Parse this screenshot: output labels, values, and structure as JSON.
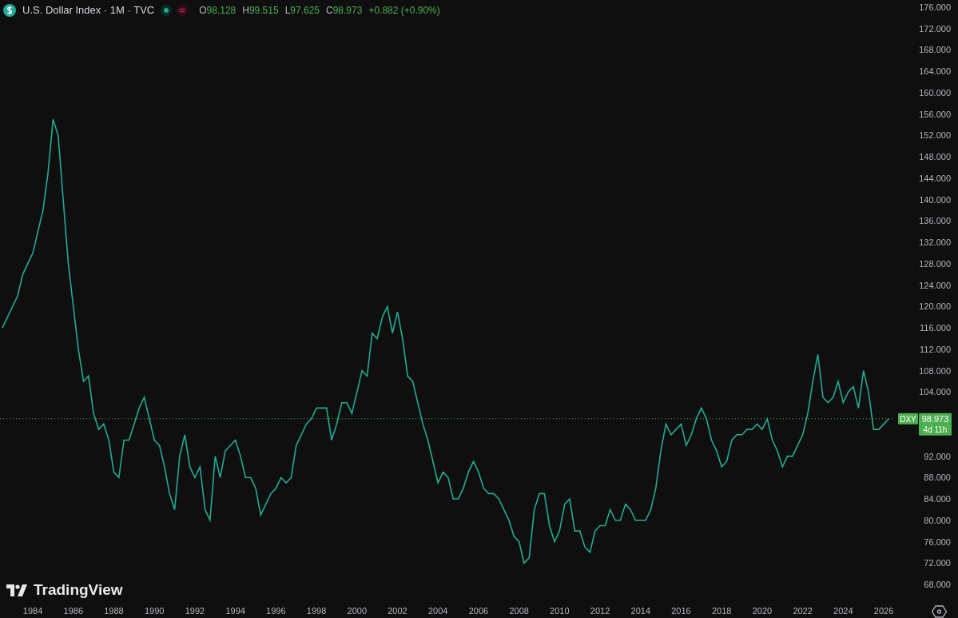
{
  "header": {
    "title": "U.S. Dollar Index · 1M · TVC",
    "ohlc": [
      {
        "label": "O",
        "value": "98.128"
      },
      {
        "label": "H",
        "value": "99.515"
      },
      {
        "label": "L",
        "value": "97.625"
      },
      {
        "label": "C",
        "value": "98.973"
      }
    ],
    "change": "+0.882 (+0.90%)"
  },
  "chart": {
    "chart_data": {
      "type": "line",
      "xlim": [
        1982.38,
        2026.55
      ],
      "ylim": [
        68,
        176
      ],
      "x": [
        1982.5,
        1982.75,
        1983,
        1983.25,
        1983.5,
        1983.75,
        1984,
        1984.25,
        1984.5,
        1984.75,
        1985,
        1985.25,
        1985.5,
        1985.75,
        1986,
        1986.25,
        1986.5,
        1986.75,
        1987,
        1987.25,
        1987.5,
        1987.75,
        1988,
        1988.25,
        1988.5,
        1988.75,
        1989,
        1989.25,
        1989.5,
        1989.75,
        1990,
        1990.25,
        1990.5,
        1990.75,
        1991,
        1991.25,
        1991.5,
        1991.75,
        1992,
        1992.25,
        1992.5,
        1992.75,
        1993,
        1993.25,
        1993.5,
        1993.75,
        1994,
        1994.25,
        1994.5,
        1994.75,
        1995,
        1995.25,
        1995.5,
        1995.75,
        1996,
        1996.25,
        1996.5,
        1996.75,
        1997,
        1997.25,
        1997.5,
        1997.75,
        1998,
        1998.25,
        1998.5,
        1998.75,
        1999,
        1999.25,
        1999.5,
        1999.75,
        2000,
        2000.25,
        2000.5,
        2000.75,
        2001,
        2001.25,
        2001.5,
        2001.75,
        2002,
        2002.25,
        2002.5,
        2002.75,
        2003,
        2003.25,
        2003.5,
        2003.75,
        2004,
        2004.25,
        2004.5,
        2004.75,
        2005,
        2005.25,
        2005.5,
        2005.75,
        2006,
        2006.25,
        2006.5,
        2006.75,
        2007,
        2007.25,
        2007.5,
        2007.75,
        2008,
        2008.25,
        2008.5,
        2008.75,
        2009,
        2009.25,
        2009.5,
        2009.75,
        2010,
        2010.25,
        2010.5,
        2010.75,
        2011,
        2011.25,
        2011.5,
        2011.75,
        2012,
        2012.25,
        2012.5,
        2012.75,
        2013,
        2013.25,
        2013.5,
        2013.75,
        2014,
        2014.25,
        2014.5,
        2014.75,
        2015,
        2015.25,
        2015.5,
        2015.75,
        2016,
        2016.25,
        2016.5,
        2016.75,
        2017,
        2017.25,
        2017.5,
        2017.75,
        2018,
        2018.25,
        2018.5,
        2018.75,
        2019,
        2019.25,
        2019.5,
        2019.75,
        2020,
        2020.25,
        2020.5,
        2020.75,
        2021,
        2021.25,
        2021.5,
        2021.75,
        2022,
        2022.25,
        2022.5,
        2022.75,
        2023,
        2023.25,
        2023.5,
        2023.75,
        2024,
        2024.25,
        2024.5,
        2024.75,
        2025,
        2025.25,
        2025.5,
        2025.75,
        2026,
        2026.25
      ],
      "series": [
        {
          "name": "DXY",
          "color": "#22ab94",
          "values": [
            116,
            118,
            120,
            122,
            126,
            128,
            130,
            134,
            138,
            145,
            155,
            152,
            140,
            128,
            120,
            112,
            106,
            107,
            100,
            97,
            98,
            95,
            89,
            88,
            95,
            95,
            98,
            101,
            103,
            99,
            95,
            94,
            90,
            85,
            82,
            92,
            96,
            90,
            88,
            90,
            82,
            80,
            92,
            88,
            93,
            94,
            95,
            92,
            88,
            88,
            86,
            81,
            83,
            85,
            86,
            88,
            87,
            88,
            94,
            96,
            98,
            99,
            101,
            101,
            101,
            95,
            98,
            102,
            102,
            100,
            104,
            108,
            107,
            115,
            114,
            118,
            120,
            115,
            119,
            114,
            107,
            106,
            102,
            98,
            95,
            91,
            87,
            89,
            88,
            84,
            84,
            86,
            89,
            91,
            89,
            86,
            85,
            85,
            84,
            82,
            80,
            77,
            76,
            72,
            73,
            82,
            85,
            85,
            79,
            76,
            78,
            83,
            84,
            78,
            78,
            75,
            74,
            78,
            79,
            79,
            82,
            80,
            80,
            83,
            82,
            80,
            80,
            80,
            82,
            86,
            93,
            98,
            96,
            97,
            98,
            94,
            96,
            99,
            101,
            99,
            95,
            93,
            90,
            91,
            95,
            96,
            96,
            97,
            97,
            98,
            97,
            99,
            95,
            93,
            90,
            92,
            92,
            94,
            96,
            100,
            106,
            111,
            103,
            102,
            103,
            106,
            102,
            104,
            105,
            101,
            108,
            104,
            97,
            97,
            98,
            99
          ]
        }
      ],
      "xticks": [
        1984,
        1986,
        1988,
        1990,
        1992,
        1994,
        1996,
        1998,
        2000,
        2002,
        2004,
        2006,
        2008,
        2010,
        2012,
        2014,
        2016,
        2018,
        2020,
        2022,
        2024,
        2026
      ],
      "yticks": [
        {
          "value": 68,
          "label": "68.000"
        },
        {
          "value": 72,
          "label": "72.000"
        },
        {
          "value": 76,
          "label": "76.000"
        },
        {
          "value": 80,
          "label": "80.000"
        },
        {
          "value": 84,
          "label": "84.000"
        },
        {
          "value": 88,
          "label": "88.000"
        },
        {
          "value": 92,
          "label": "92.000"
        },
        {
          "value": 104,
          "label": "104.000"
        },
        {
          "value": 108,
          "label": "108.000"
        },
        {
          "value": 112,
          "label": "112.000"
        },
        {
          "value": 116,
          "label": "116.000"
        },
        {
          "value": 120,
          "label": "120.000"
        },
        {
          "value": 124,
          "label": "124.000"
        },
        {
          "value": 128,
          "label": "128.000"
        },
        {
          "value": 132,
          "label": "132.000"
        },
        {
          "value": 136,
          "label": "136.000"
        },
        {
          "value": 140,
          "label": "140.000"
        },
        {
          "value": 144,
          "label": "144.000"
        },
        {
          "value": 148,
          "label": "148.000"
        },
        {
          "value": 152,
          "label": "152.000"
        },
        {
          "value": 156,
          "label": "156.000"
        },
        {
          "value": 160,
          "label": "160.000"
        },
        {
          "value": 164,
          "label": "164.000"
        },
        {
          "value": 168,
          "label": "168.000"
        },
        {
          "value": 172,
          "label": "172.000"
        },
        {
          "value": 176,
          "label": "176.000"
        }
      ]
    },
    "price_tag": {
      "price": "98.973",
      "countdown": "4d 11h"
    }
  },
  "watermark_logo": {
    "text": "TradingView"
  }
}
